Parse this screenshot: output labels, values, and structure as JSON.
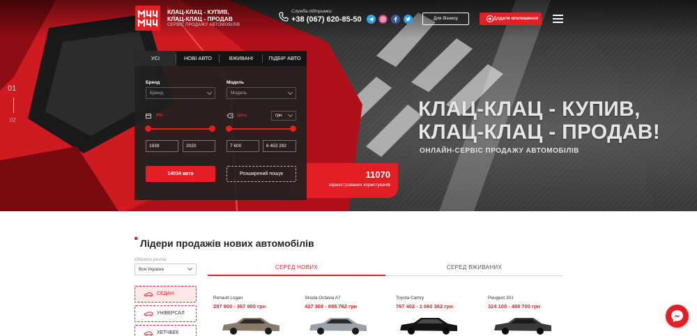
{
  "header": {
    "logo_line1": "КЛАЦ-КЛАЦ - КУПИВ,",
    "logo_line2": "КЛАЦ-КЛАЦ - ПРОДАВ",
    "logo_sub": "СЕРВІС ПРОДАЖУ АВТОМОБІЛІВ",
    "support_label": "Служба підтримки:",
    "phone": "+38 (067) 620-85-50",
    "business_label": "Для бізнесу",
    "add_label": "Додати оголошення"
  },
  "socials": [
    "telegram-icon",
    "instagram-icon",
    "facebook-icon",
    "twitter-icon"
  ],
  "slider": {
    "current": "01",
    "next": "02"
  },
  "hero": {
    "headline_line1": "КЛАЦ-КЛАЦ - КУПИВ,",
    "headline_line2": "КЛАЦ-КЛАЦ - ПРОДАВ!",
    "subtitle": "ОНЛАЙН-СЕРВІС ПРОДАЖУ АВТОМОБІЛІВ"
  },
  "search": {
    "tabs": [
      "УСІ",
      "НОВІ АВТО",
      "ВЖИВАНІ",
      "ПІДБІР АВТО"
    ],
    "active_tab": 0,
    "brand_label": "Бренд",
    "brand_placeholder": "Бренд",
    "model_label": "Модель",
    "model_placeholder": "Модель",
    "year_label": "Рік",
    "price_label": "Ціна",
    "currency": "грн",
    "year_from": "1939",
    "year_to": "2020",
    "price_from": "7 600",
    "price_to": "6 453 292",
    "found_label": "14034 авто",
    "advanced_label": "Розширений пошук"
  },
  "users": {
    "count": "11070",
    "label": "зареєстрованих користувачів"
  },
  "leaders": {
    "title": "Лідери продажів нових автомобілів",
    "region_label": "Обрати регіон",
    "region_value": "Вся Україна",
    "tab_new": "СЕРЕД НОВИХ",
    "tab_used": "СЕРЕД ВЖИВАНИХ",
    "body_types": [
      "СЕДАН",
      "УНІВЕРСАЛ",
      "ХЕТЧБЕК"
    ],
    "cars": [
      {
        "name": "Renault Logan",
        "price": "297 900 - 367 900 грн",
        "color": "#8a7a6a"
      },
      {
        "name": "Skoda Octavia A7",
        "price": "427 308 - 895 762 грн",
        "color": "#9aa2a8"
      },
      {
        "name": "Toyota Camry",
        "price": "767 402 - 1 060 382 грн",
        "color": "#151515"
      },
      {
        "name": "Peugeot 301",
        "price": "324 100 - 458 700 грн",
        "color": "#3a3a3a"
      }
    ]
  },
  "colors": {
    "accent": "#e31e24",
    "panel": "#1f1f1f"
  },
  "messenger_icon": "messenger-icon"
}
